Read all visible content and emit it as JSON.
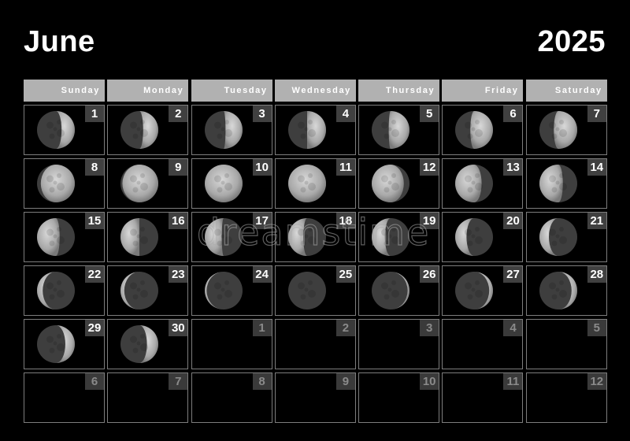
{
  "header": {
    "month": "June",
    "year": "2025"
  },
  "weekdays": [
    "Sunday",
    "Monday",
    "Tuesday",
    "Wednesday",
    "Thursday",
    "Friday",
    "Saturday"
  ],
  "colors": {
    "background": "#000000",
    "weekday_header_bg": "#b1b1b1",
    "date_badge_bg": "#404040",
    "cell_border": "#7d7d7d",
    "current_month_text": "#ffffff",
    "other_month_text": "#8a8a8a"
  },
  "cells": [
    {
      "day": "1",
      "current": true,
      "moon": {
        "lit_fraction": 0.35,
        "lit_side": "right"
      }
    },
    {
      "day": "2",
      "current": true,
      "moon": {
        "lit_fraction": 0.4,
        "lit_side": "right"
      }
    },
    {
      "day": "3",
      "current": true,
      "moon": {
        "lit_fraction": 0.45,
        "lit_side": "right"
      }
    },
    {
      "day": "4",
      "current": true,
      "moon": {
        "lit_fraction": 0.5,
        "lit_side": "right"
      }
    },
    {
      "day": "5",
      "current": true,
      "moon": {
        "lit_fraction": 0.55,
        "lit_side": "right"
      }
    },
    {
      "day": "6",
      "current": true,
      "moon": {
        "lit_fraction": 0.6,
        "lit_side": "right"
      }
    },
    {
      "day": "7",
      "current": true,
      "moon": {
        "lit_fraction": 0.62,
        "lit_side": "right"
      }
    },
    {
      "day": "8",
      "current": true,
      "moon": {
        "lit_fraction": 0.9,
        "lit_side": "right"
      }
    },
    {
      "day": "9",
      "current": true,
      "moon": {
        "lit_fraction": 0.95,
        "lit_side": "right"
      }
    },
    {
      "day": "10",
      "current": true,
      "moon": {
        "lit_fraction": 1.0,
        "lit_side": "right"
      }
    },
    {
      "day": "11",
      "current": true,
      "moon": {
        "lit_fraction": 1.0,
        "lit_side": "left"
      }
    },
    {
      "day": "12",
      "current": true,
      "moon": {
        "lit_fraction": 0.85,
        "lit_side": "left"
      }
    },
    {
      "day": "13",
      "current": true,
      "moon": {
        "lit_fraction": 0.7,
        "lit_side": "left"
      }
    },
    {
      "day": "14",
      "current": true,
      "moon": {
        "lit_fraction": 0.62,
        "lit_side": "left"
      }
    },
    {
      "day": "15",
      "current": true,
      "moon": {
        "lit_fraction": 0.6,
        "lit_side": "left"
      }
    },
    {
      "day": "16",
      "current": true,
      "moon": {
        "lit_fraction": 0.5,
        "lit_side": "left"
      }
    },
    {
      "day": "17",
      "current": true,
      "moon": {
        "lit_fraction": 0.45,
        "lit_side": "left"
      }
    },
    {
      "day": "18",
      "current": true,
      "moon": {
        "lit_fraction": 0.4,
        "lit_side": "left"
      }
    },
    {
      "day": "19",
      "current": true,
      "moon": {
        "lit_fraction": 0.35,
        "lit_side": "left"
      }
    },
    {
      "day": "20",
      "current": true,
      "moon": {
        "lit_fraction": 0.3,
        "lit_side": "left"
      }
    },
    {
      "day": "21",
      "current": true,
      "moon": {
        "lit_fraction": 0.25,
        "lit_side": "left"
      }
    },
    {
      "day": "22",
      "current": true,
      "moon": {
        "lit_fraction": 0.15,
        "lit_side": "left"
      }
    },
    {
      "day": "23",
      "current": true,
      "moon": {
        "lit_fraction": 0.1,
        "lit_side": "left"
      }
    },
    {
      "day": "24",
      "current": true,
      "moon": {
        "lit_fraction": 0.05,
        "lit_side": "left"
      }
    },
    {
      "day": "25",
      "current": true,
      "moon": {
        "lit_fraction": 0.0,
        "lit_side": "left"
      }
    },
    {
      "day": "26",
      "current": true,
      "moon": {
        "lit_fraction": 0.05,
        "lit_side": "right"
      }
    },
    {
      "day": "27",
      "current": true,
      "moon": {
        "lit_fraction": 0.1,
        "lit_side": "right"
      }
    },
    {
      "day": "28",
      "current": true,
      "moon": {
        "lit_fraction": 0.15,
        "lit_side": "right"
      }
    },
    {
      "day": "29",
      "current": true,
      "moon": {
        "lit_fraction": 0.25,
        "lit_side": "right"
      }
    },
    {
      "day": "30",
      "current": true,
      "moon": {
        "lit_fraction": 0.3,
        "lit_side": "right"
      }
    },
    {
      "day": "1",
      "current": false
    },
    {
      "day": "2",
      "current": false
    },
    {
      "day": "3",
      "current": false
    },
    {
      "day": "4",
      "current": false
    },
    {
      "day": "5",
      "current": false
    },
    {
      "day": "6",
      "current": false
    },
    {
      "day": "7",
      "current": false
    },
    {
      "day": "8",
      "current": false
    },
    {
      "day": "9",
      "current": false
    },
    {
      "day": "10",
      "current": false
    },
    {
      "day": "11",
      "current": false
    },
    {
      "day": "12",
      "current": false
    }
  ],
  "watermark": {
    "text": "dreamstime",
    "mark": "®"
  }
}
